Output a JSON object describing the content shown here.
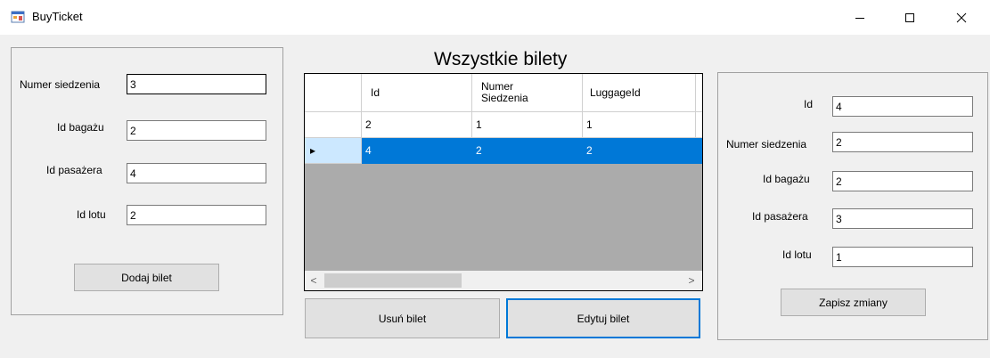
{
  "window": {
    "title": "BuyTicket",
    "icon": "app-window-icon",
    "controls": {
      "minimize": "–",
      "maximize": "☐",
      "close": "✕"
    }
  },
  "add_form": {
    "seat_label": "Numer siedzenia",
    "seat_value": "3",
    "luggage_label": "Id bagażu",
    "luggage_value": "2",
    "passenger_label": "Id pasażera",
    "passenger_value": "4",
    "flight_label": "Id lotu",
    "flight_value": "2",
    "add_button": "Dodaj bilet"
  },
  "tickets": {
    "heading": "Wszystkie bilety",
    "columns": [
      "Id",
      "Numer\nSiedzenia",
      "LuggageId"
    ],
    "rows": [
      {
        "id": "2",
        "seat": "1",
        "luggage": "1",
        "selected": false
      },
      {
        "id": "4",
        "seat": "2",
        "luggage": "2",
        "selected": true
      }
    ],
    "row_indicator": "▸",
    "scroll_left": "<",
    "scroll_right": ">",
    "delete_button": "Usuń bilet",
    "edit_button": "Edytuj bilet"
  },
  "edit_form": {
    "id_label": "Id",
    "id_value": "4",
    "seat_label": "Numer siedzenia",
    "seat_value": "2",
    "luggage_label": "Id bagażu",
    "luggage_value": "2",
    "passenger_label": "Id pasażera",
    "passenger_value": "3",
    "flight_label": "Id lotu",
    "flight_value": "1",
    "save_button": "Zapisz zmiany"
  },
  "colors": {
    "selection": "#0078d7",
    "row_header_selected": "#cce8ff",
    "grid_background": "#ababab",
    "window_background": "#f0f0f0"
  }
}
